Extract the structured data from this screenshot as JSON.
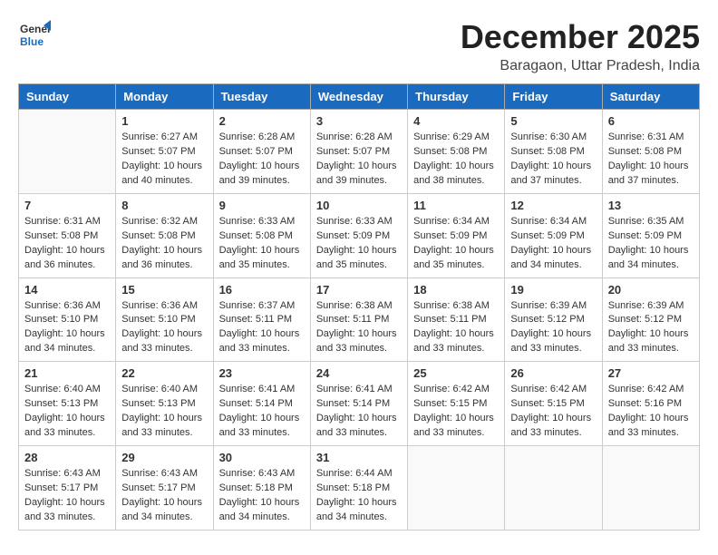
{
  "header": {
    "logo_general": "General",
    "logo_blue": "Blue",
    "month_year": "December 2025",
    "location": "Baragaon, Uttar Pradesh, India"
  },
  "days_of_week": [
    "Sunday",
    "Monday",
    "Tuesday",
    "Wednesday",
    "Thursday",
    "Friday",
    "Saturday"
  ],
  "weeks": [
    [
      {
        "day": "",
        "info": ""
      },
      {
        "day": "1",
        "info": "Sunrise: 6:27 AM\nSunset: 5:07 PM\nDaylight: 10 hours\nand 40 minutes."
      },
      {
        "day": "2",
        "info": "Sunrise: 6:28 AM\nSunset: 5:07 PM\nDaylight: 10 hours\nand 39 minutes."
      },
      {
        "day": "3",
        "info": "Sunrise: 6:28 AM\nSunset: 5:07 PM\nDaylight: 10 hours\nand 39 minutes."
      },
      {
        "day": "4",
        "info": "Sunrise: 6:29 AM\nSunset: 5:08 PM\nDaylight: 10 hours\nand 38 minutes."
      },
      {
        "day": "5",
        "info": "Sunrise: 6:30 AM\nSunset: 5:08 PM\nDaylight: 10 hours\nand 37 minutes."
      },
      {
        "day": "6",
        "info": "Sunrise: 6:31 AM\nSunset: 5:08 PM\nDaylight: 10 hours\nand 37 minutes."
      }
    ],
    [
      {
        "day": "7",
        "info": "Sunrise: 6:31 AM\nSunset: 5:08 PM\nDaylight: 10 hours\nand 36 minutes."
      },
      {
        "day": "8",
        "info": "Sunrise: 6:32 AM\nSunset: 5:08 PM\nDaylight: 10 hours\nand 36 minutes."
      },
      {
        "day": "9",
        "info": "Sunrise: 6:33 AM\nSunset: 5:08 PM\nDaylight: 10 hours\nand 35 minutes."
      },
      {
        "day": "10",
        "info": "Sunrise: 6:33 AM\nSunset: 5:09 PM\nDaylight: 10 hours\nand 35 minutes."
      },
      {
        "day": "11",
        "info": "Sunrise: 6:34 AM\nSunset: 5:09 PM\nDaylight: 10 hours\nand 35 minutes."
      },
      {
        "day": "12",
        "info": "Sunrise: 6:34 AM\nSunset: 5:09 PM\nDaylight: 10 hours\nand 34 minutes."
      },
      {
        "day": "13",
        "info": "Sunrise: 6:35 AM\nSunset: 5:09 PM\nDaylight: 10 hours\nand 34 minutes."
      }
    ],
    [
      {
        "day": "14",
        "info": "Sunrise: 6:36 AM\nSunset: 5:10 PM\nDaylight: 10 hours\nand 34 minutes."
      },
      {
        "day": "15",
        "info": "Sunrise: 6:36 AM\nSunset: 5:10 PM\nDaylight: 10 hours\nand 33 minutes."
      },
      {
        "day": "16",
        "info": "Sunrise: 6:37 AM\nSunset: 5:11 PM\nDaylight: 10 hours\nand 33 minutes."
      },
      {
        "day": "17",
        "info": "Sunrise: 6:38 AM\nSunset: 5:11 PM\nDaylight: 10 hours\nand 33 minutes."
      },
      {
        "day": "18",
        "info": "Sunrise: 6:38 AM\nSunset: 5:11 PM\nDaylight: 10 hours\nand 33 minutes."
      },
      {
        "day": "19",
        "info": "Sunrise: 6:39 AM\nSunset: 5:12 PM\nDaylight: 10 hours\nand 33 minutes."
      },
      {
        "day": "20",
        "info": "Sunrise: 6:39 AM\nSunset: 5:12 PM\nDaylight: 10 hours\nand 33 minutes."
      }
    ],
    [
      {
        "day": "21",
        "info": "Sunrise: 6:40 AM\nSunset: 5:13 PM\nDaylight: 10 hours\nand 33 minutes."
      },
      {
        "day": "22",
        "info": "Sunrise: 6:40 AM\nSunset: 5:13 PM\nDaylight: 10 hours\nand 33 minutes."
      },
      {
        "day": "23",
        "info": "Sunrise: 6:41 AM\nSunset: 5:14 PM\nDaylight: 10 hours\nand 33 minutes."
      },
      {
        "day": "24",
        "info": "Sunrise: 6:41 AM\nSunset: 5:14 PM\nDaylight: 10 hours\nand 33 minutes."
      },
      {
        "day": "25",
        "info": "Sunrise: 6:42 AM\nSunset: 5:15 PM\nDaylight: 10 hours\nand 33 minutes."
      },
      {
        "day": "26",
        "info": "Sunrise: 6:42 AM\nSunset: 5:15 PM\nDaylight: 10 hours\nand 33 minutes."
      },
      {
        "day": "27",
        "info": "Sunrise: 6:42 AM\nSunset: 5:16 PM\nDaylight: 10 hours\nand 33 minutes."
      }
    ],
    [
      {
        "day": "28",
        "info": "Sunrise: 6:43 AM\nSunset: 5:17 PM\nDaylight: 10 hours\nand 33 minutes."
      },
      {
        "day": "29",
        "info": "Sunrise: 6:43 AM\nSunset: 5:17 PM\nDaylight: 10 hours\nand 34 minutes."
      },
      {
        "day": "30",
        "info": "Sunrise: 6:43 AM\nSunset: 5:18 PM\nDaylight: 10 hours\nand 34 minutes."
      },
      {
        "day": "31",
        "info": "Sunrise: 6:44 AM\nSunset: 5:18 PM\nDaylight: 10 hours\nand 34 minutes."
      },
      {
        "day": "",
        "info": ""
      },
      {
        "day": "",
        "info": ""
      },
      {
        "day": "",
        "info": ""
      }
    ]
  ]
}
